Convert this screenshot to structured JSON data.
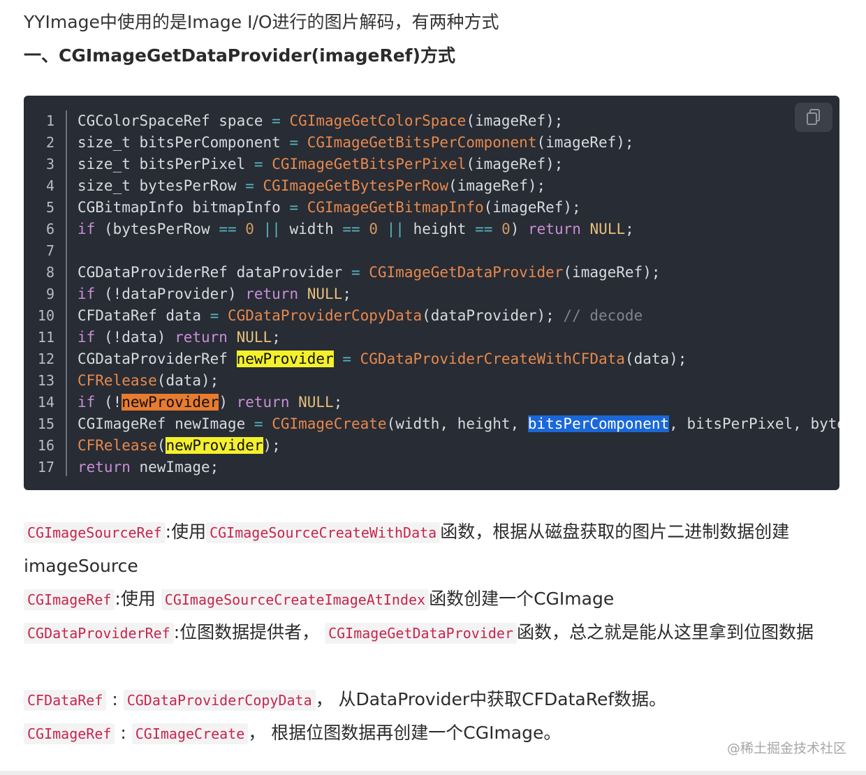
{
  "intro_text": "YYImage中使用的是Image I/O进行的图片解码，有两种方式",
  "heading": "一、CGImageGetDataProvider(imageRef)方式",
  "code": {
    "line_numbers": [
      "1",
      "2",
      "3",
      "4",
      "5",
      "6",
      "7",
      "8",
      "9",
      "10",
      "11",
      "12",
      "13",
      "14",
      "15",
      "16",
      "17"
    ],
    "lines": [
      [
        {
          "t": "CGColorSpaceRef space ",
          "c": "p"
        },
        {
          "t": "=",
          "c": "op"
        },
        {
          "t": " ",
          "c": "p"
        },
        {
          "t": "CGImageGetColorSpace",
          "c": "fn"
        },
        {
          "t": "(imageRef);",
          "c": "p"
        }
      ],
      [
        {
          "t": "size_t bitsPerComponent ",
          "c": "p"
        },
        {
          "t": "=",
          "c": "op"
        },
        {
          "t": " ",
          "c": "p"
        },
        {
          "t": "CGImageGetBitsPerComponent",
          "c": "fn"
        },
        {
          "t": "(imageRef);",
          "c": "p"
        }
      ],
      [
        {
          "t": "size_t bitsPerPixel ",
          "c": "p"
        },
        {
          "t": "=",
          "c": "op"
        },
        {
          "t": " ",
          "c": "p"
        },
        {
          "t": "CGImageGetBitsPerPixel",
          "c": "fn"
        },
        {
          "t": "(imageRef);",
          "c": "p"
        }
      ],
      [
        {
          "t": "size_t bytesPerRow ",
          "c": "p"
        },
        {
          "t": "=",
          "c": "op"
        },
        {
          "t": " ",
          "c": "p"
        },
        {
          "t": "CGImageGetBytesPerRow",
          "c": "fn"
        },
        {
          "t": "(imageRef);",
          "c": "p"
        }
      ],
      [
        {
          "t": "CGBitmapInfo bitmapInfo ",
          "c": "p"
        },
        {
          "t": "=",
          "c": "op"
        },
        {
          "t": " ",
          "c": "p"
        },
        {
          "t": "CGImageGetBitmapInfo",
          "c": "fn"
        },
        {
          "t": "(imageRef);",
          "c": "p"
        }
      ],
      [
        {
          "t": "if",
          "c": "kw"
        },
        {
          "t": " (bytesPerRow ",
          "c": "p"
        },
        {
          "t": "==",
          "c": "op"
        },
        {
          "t": " ",
          "c": "p"
        },
        {
          "t": "0",
          "c": "num"
        },
        {
          "t": " ",
          "c": "p"
        },
        {
          "t": "||",
          "c": "op"
        },
        {
          "t": " width ",
          "c": "p"
        },
        {
          "t": "==",
          "c": "op"
        },
        {
          "t": " ",
          "c": "p"
        },
        {
          "t": "0",
          "c": "num"
        },
        {
          "t": " ",
          "c": "p"
        },
        {
          "t": "||",
          "c": "op"
        },
        {
          "t": " height ",
          "c": "p"
        },
        {
          "t": "==",
          "c": "op"
        },
        {
          "t": " ",
          "c": "p"
        },
        {
          "t": "0",
          "c": "num"
        },
        {
          "t": ") ",
          "c": "p"
        },
        {
          "t": "return",
          "c": "kw"
        },
        {
          "t": " ",
          "c": "p"
        },
        {
          "t": "NULL",
          "c": "nl"
        },
        {
          "t": ";",
          "c": "p"
        }
      ],
      [],
      [
        {
          "t": "CGDataProviderRef dataProvider ",
          "c": "p"
        },
        {
          "t": "=",
          "c": "op"
        },
        {
          "t": " ",
          "c": "p"
        },
        {
          "t": "CGImageGetDataProvider",
          "c": "fn"
        },
        {
          "t": "(imageRef);",
          "c": "p"
        }
      ],
      [
        {
          "t": "if",
          "c": "kw"
        },
        {
          "t": " (!dataProvider) ",
          "c": "p"
        },
        {
          "t": "return",
          "c": "kw"
        },
        {
          "t": " ",
          "c": "p"
        },
        {
          "t": "NULL",
          "c": "nl"
        },
        {
          "t": ";",
          "c": "p"
        }
      ],
      [
        {
          "t": "CFDataRef data ",
          "c": "p"
        },
        {
          "t": "=",
          "c": "op"
        },
        {
          "t": " ",
          "c": "p"
        },
        {
          "t": "CGDataProviderCopyData",
          "c": "fn"
        },
        {
          "t": "(dataProvider); ",
          "c": "p"
        },
        {
          "t": "// decode",
          "c": "cm"
        }
      ],
      [
        {
          "t": "if",
          "c": "kw"
        },
        {
          "t": " (!data) ",
          "c": "p"
        },
        {
          "t": "return",
          "c": "kw"
        },
        {
          "t": " ",
          "c": "p"
        },
        {
          "t": "NULL",
          "c": "nl"
        },
        {
          "t": ";",
          "c": "p"
        }
      ],
      [
        {
          "t": "CGDataProviderRef ",
          "c": "p"
        },
        {
          "t": "newProvider",
          "c": "hl-y"
        },
        {
          "t": " ",
          "c": "p"
        },
        {
          "t": "=",
          "c": "op"
        },
        {
          "t": " ",
          "c": "p"
        },
        {
          "t": "CGDataProviderCreateWithCFData",
          "c": "fn"
        },
        {
          "t": "(data);",
          "c": "p"
        }
      ],
      [
        {
          "t": "CFRelease",
          "c": "fn"
        },
        {
          "t": "(data);",
          "c": "p"
        }
      ],
      [
        {
          "t": "if",
          "c": "kw"
        },
        {
          "t": " (!",
          "c": "p"
        },
        {
          "t": "newProvider",
          "c": "hl-o"
        },
        {
          "t": ") ",
          "c": "p"
        },
        {
          "t": "return",
          "c": "kw"
        },
        {
          "t": " ",
          "c": "p"
        },
        {
          "t": "NULL",
          "c": "nl"
        },
        {
          "t": ";",
          "c": "p"
        }
      ],
      [
        {
          "t": "CGImageRef newImage ",
          "c": "p"
        },
        {
          "t": "=",
          "c": "op"
        },
        {
          "t": " ",
          "c": "p"
        },
        {
          "t": "CGImageCreate",
          "c": "fn"
        },
        {
          "t": "(width, height, ",
          "c": "p"
        },
        {
          "t": "bitsPerComponent",
          "c": "hl-b"
        },
        {
          "t": ", bitsPerPixel, bytesPerRow",
          "c": "p"
        }
      ],
      [
        {
          "t": "CFRelease",
          "c": "fn"
        },
        {
          "t": "(",
          "c": "p"
        },
        {
          "t": "newProvider",
          "c": "hl-y"
        },
        {
          "t": ");",
          "c": "p"
        }
      ],
      [
        {
          "t": "return",
          "c": "kw"
        },
        {
          "t": " newImage;",
          "c": "p"
        }
      ]
    ]
  },
  "paragraphs": [
    [
      {
        "code": "CGImageSourceRef"
      },
      {
        "text": ":使用"
      },
      {
        "code": "CGImageSourceCreateWithData"
      },
      {
        "text": "函数，根据从磁盘获取的图片二进制数据创建imageSource"
      }
    ],
    [
      {
        "code": "CGImageRef"
      },
      {
        "text": ":使用 "
      },
      {
        "code": "CGImageSourceCreateImageAtIndex"
      },
      {
        "text": "函数创建一个CGImage"
      }
    ],
    [
      {
        "code": "CGDataProviderRef"
      },
      {
        "text": ":位图数据提供者， "
      },
      {
        "code": "CGImageGetDataProvider"
      },
      {
        "text": "函数，总之就是能从这里拿到位图数据"
      }
    ],
    [
      {
        "code": "CFDataRef"
      },
      {
        "text": " : "
      },
      {
        "code": "CGDataProviderCopyData"
      },
      {
        "text": "， 从DataProvider中获取CFDataRef数据。"
      }
    ],
    [
      {
        "code": "CGImageRef"
      },
      {
        "text": " : "
      },
      {
        "code": "CGImageCreate"
      },
      {
        "text": "， 根据位图数据再创建一个CGImage。"
      }
    ]
  ],
  "watermark": "@稀土掘金技术社区",
  "icons": {
    "copy": "copy-icon"
  }
}
